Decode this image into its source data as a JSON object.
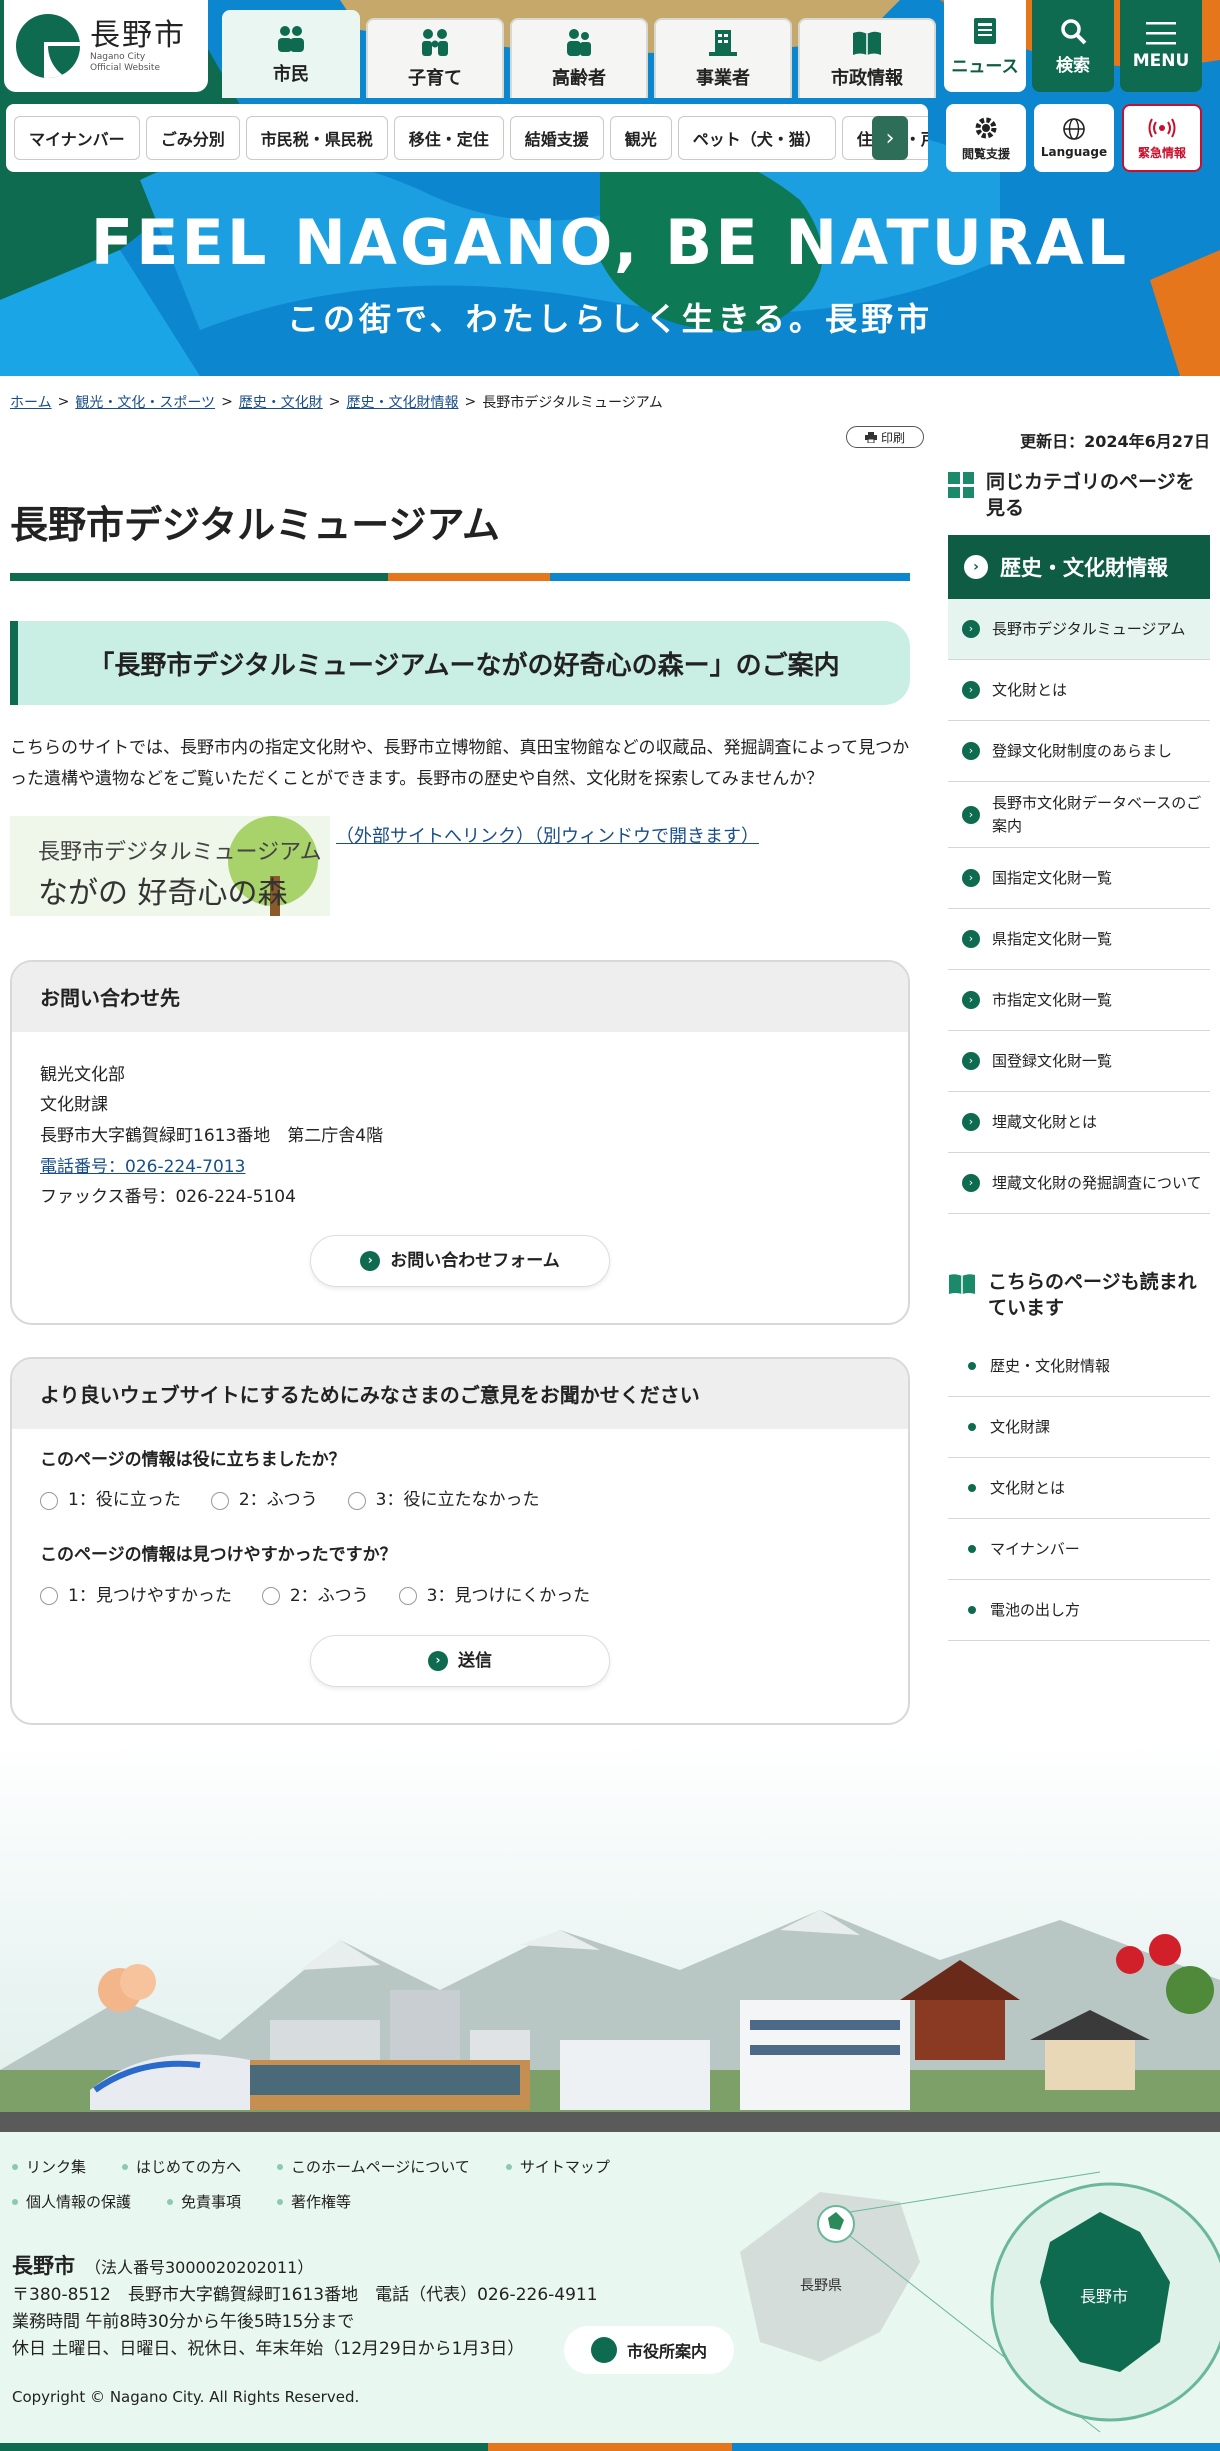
{
  "site": {
    "name": "長野市",
    "sub1": "Nagano City",
    "sub2": "Official Website"
  },
  "main_nav": [
    "市民",
    "子育て",
    "高齢者",
    "事業者",
    "市政情報"
  ],
  "util_nav": [
    "ニュース",
    "検索",
    "MENU"
  ],
  "sub_nav": [
    "マイナンバー",
    "ごみ分別",
    "市民税・県民税",
    "移住・定住",
    "結婚支援",
    "観光",
    "ペット（犬・猫）",
    "住民票・戸"
  ],
  "small_util": [
    "閲覧支援",
    "Language",
    "緊急情報"
  ],
  "hero": {
    "title": "FEEL NAGANO, BE NATURAL",
    "subtitle": "この街で、わたしらしく生きる。長野市"
  },
  "breadcrumb": {
    "items": [
      "ホーム",
      "観光・文化・スポーツ",
      "歴史・文化財",
      "歴史・文化財情報"
    ],
    "current": "長野市デジタルミュージアム",
    "sep": ">"
  },
  "print_label": "印刷",
  "updated": "更新日：2024年6月27日",
  "page": {
    "title": "長野市デジタルミュージアム",
    "h2": "「長野市デジタルミュージアムーながの好奇心の森ー」のご案内",
    "intro": "こちらのサイトでは、長野市内の指定文化財や、長野市立博物館、真田宝物館などの収蔵品、発掘調査によって見つかった遺構や遺物などをご覧いただくことができます。長野市の歴史や自然、文化財を探索してみませんか？",
    "banner_line1": "長野市デジタルミュージアム",
    "banner_line2": "ながの 好奇心の森",
    "banner_link": "（外部サイトへリンク）（別ウィンドウで開きます）"
  },
  "contact": {
    "heading": "お問い合わせ先",
    "dept": "観光文化部",
    "section": "文化財課",
    "address": "長野市大字鶴賀緑町1613番地　第二庁舎4階",
    "tel": "電話番号：026-224-7013",
    "fax": "ファックス番号：026-224-5104",
    "form_btn": "お問い合わせフォーム"
  },
  "survey": {
    "heading": "より良いウェブサイトにするためにみなさまのご意見をお聞かせください",
    "q1": "このページの情報は役に立ちましたか？",
    "q1_opts": [
      "1：役に立った",
      "2：ふつう",
      "3：役に立たなかった"
    ],
    "q2": "このページの情報は見つけやすかったですか？",
    "q2_opts": [
      "1：見つけやすかった",
      "2：ふつう",
      "3：見つけにくかった"
    ],
    "submit": "送信"
  },
  "sidebar": {
    "head1": "同じカテゴリのページを見る",
    "category": "歴史・文化財情報",
    "items": [
      "長野市デジタルミュージアム",
      "文化財とは",
      "登録文化財制度のあらまし",
      "長野市文化財データベースのご案内",
      "国指定文化財一覧",
      "県指定文化財一覧",
      "市指定文化財一覧",
      "国登録文化財一覧",
      "埋蔵文化財とは",
      "埋蔵文化財の発掘調査について"
    ],
    "head2": "こちらのページも読まれています",
    "items2": [
      "歴史・文化財情報",
      "文化財課",
      "文化財とは",
      "マイナンバー",
      "電池の出し方"
    ]
  },
  "footer": {
    "links": [
      "リンク集",
      "はじめての方へ",
      "このホームページについて",
      "サイトマップ",
      "個人情報の保護",
      "免責事項",
      "著作権等"
    ],
    "city": "長野市",
    "corp_no": "（法人番号3000020202011）",
    "address": "〒380-8512　長野市大字鶴賀緑町1613番地　電話（代表）026-226-4911",
    "hours": "業務時間 午前8時30分から午後5時15分まで",
    "holidays": "休日 土曜日、日曜日、祝休日、年末年始（12月29日から1月3日）",
    "guide_btn": "市役所案内",
    "copyright": "Copyright © Nagano City. All Rights Reserved.",
    "map_pref": "長野県",
    "map_city": "長野市"
  },
  "colors": {
    "brand_green": "#0f6b4f",
    "accent_orange": "#e6761b",
    "accent_blue": "#0b86cf",
    "alert_red": "#c8102e"
  }
}
